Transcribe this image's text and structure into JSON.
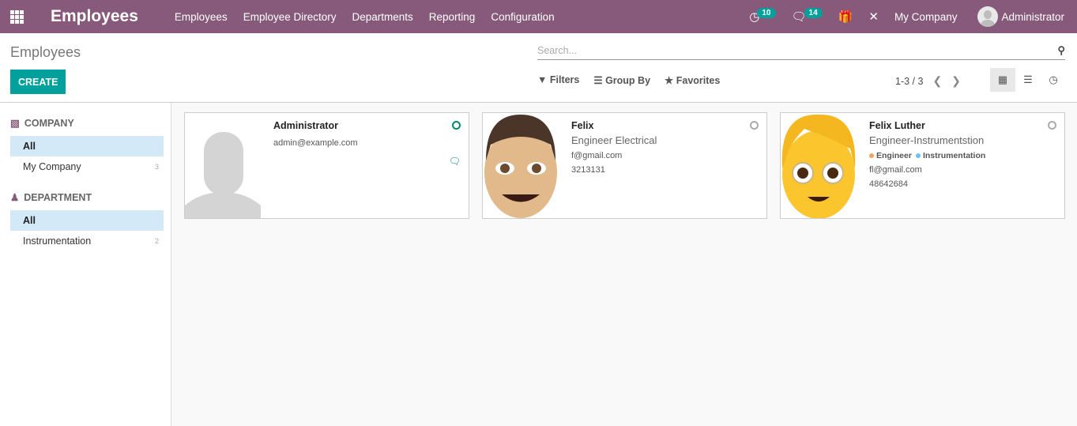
{
  "navbar": {
    "brand": "Employees",
    "menu": [
      "Employees",
      "Employee Directory",
      "Departments",
      "Reporting",
      "Configuration"
    ],
    "activities_count": "10",
    "messages_count": "14",
    "company": "My Company",
    "user": "Administrator"
  },
  "control_panel": {
    "title": "Employees",
    "create_label": "CREATE",
    "search_placeholder": "Search...",
    "filters_label": "Filters",
    "groupby_label": "Group By",
    "favorites_label": "Favorites",
    "pager": "1-3 / 3"
  },
  "sidebar": {
    "company": {
      "title": "COMPANY",
      "items": [
        {
          "label": "All",
          "count": ""
        },
        {
          "label": "My Company",
          "count": "3"
        }
      ]
    },
    "department": {
      "title": "DEPARTMENT",
      "items": [
        {
          "label": "All",
          "count": ""
        },
        {
          "label": "Instrumentation",
          "count": "2"
        }
      ]
    }
  },
  "employees": [
    {
      "name": "Administrator",
      "email": "admin@example.com",
      "status": "online"
    },
    {
      "name": "Felix",
      "job": "Engineer Electrical",
      "email": "f@gmail.com",
      "phone": "3213131",
      "status": "offline"
    },
    {
      "name": "Felix Luther",
      "job": "Engineer-Instrumentstion",
      "tags": [
        {
          "label": "Engineer",
          "color": "#f4a460"
        },
        {
          "label": "Instrumentation",
          "color": "#6cc1ed"
        }
      ],
      "email": "fl@gmail.com",
      "phone": "48642684",
      "status": "offline"
    }
  ],
  "colors": {
    "brand": "#875a7b",
    "accent": "#00a09d"
  }
}
